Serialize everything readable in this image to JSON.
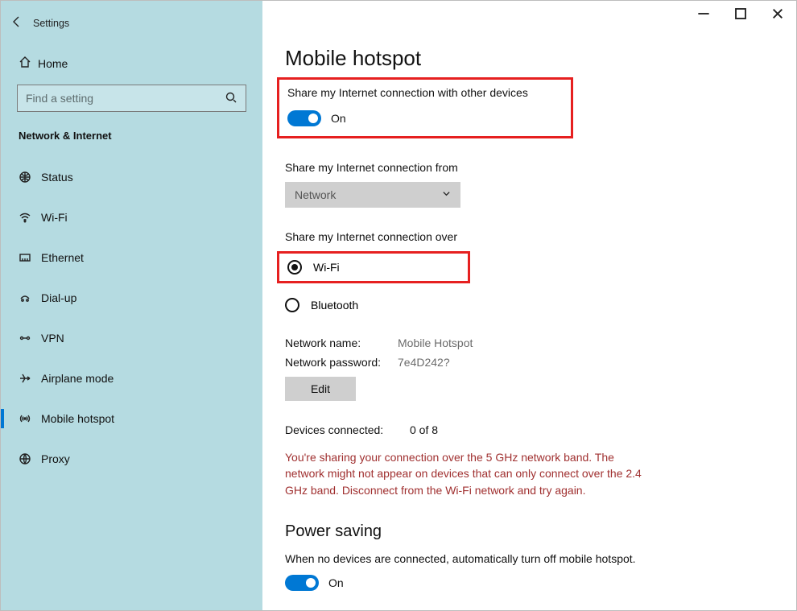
{
  "app_title": "Settings",
  "search_placeholder": "Find a setting",
  "home_label": "Home",
  "category_title": "Network & Internet",
  "nav": [
    {
      "label": "Status"
    },
    {
      "label": "Wi-Fi"
    },
    {
      "label": "Ethernet"
    },
    {
      "label": "Dial-up"
    },
    {
      "label": "VPN"
    },
    {
      "label": "Airplane mode"
    },
    {
      "label": "Mobile hotspot"
    },
    {
      "label": "Proxy"
    }
  ],
  "page": {
    "title": "Mobile hotspot",
    "share_label": "Share my Internet connection with other devices",
    "share_toggle_state": "On",
    "from_label": "Share my Internet connection from",
    "from_value": "Network",
    "over_label": "Share my Internet connection over",
    "over_options": {
      "wifi": "Wi-Fi",
      "bluetooth": "Bluetooth"
    },
    "network_name_label": "Network name:",
    "network_name_value": "Mobile Hotspot",
    "network_password_label": "Network password:",
    "network_password_value": "7e4D242?",
    "edit_label": "Edit",
    "devices_connected_label": "Devices connected:",
    "devices_connected_value": "0 of 8",
    "warning_text": "You're sharing your connection over the 5 GHz network band. The network might not appear on devices that can only connect over the 2.4 GHz band. Disconnect from the Wi-Fi network and try again.",
    "power_saving_title": "Power saving",
    "power_saving_desc": "When no devices are connected, automatically turn off mobile hotspot.",
    "power_saving_state": "On"
  }
}
